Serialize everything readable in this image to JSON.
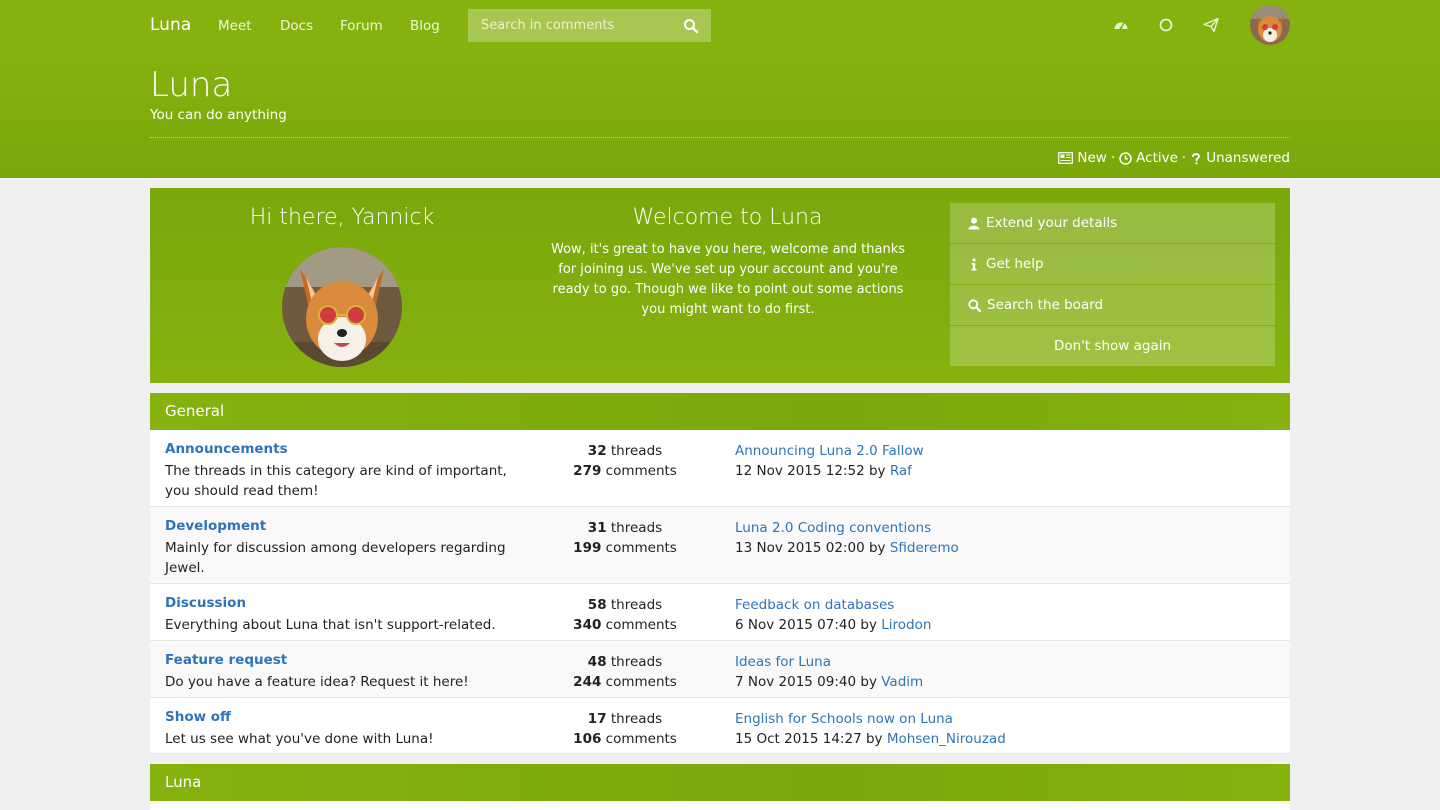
{
  "navbar": {
    "brand": "Luna",
    "links": [
      "Meet",
      "Docs",
      "Forum",
      "Blog"
    ],
    "search_placeholder": "Search in comments",
    "icons": [
      "dashboard-icon",
      "circle-icon",
      "send-icon"
    ]
  },
  "header": {
    "title": "Luna",
    "subtitle": "You can do anything",
    "quick_links": [
      "New",
      "Active",
      "Unanswered"
    ]
  },
  "welcome": {
    "greeting": "Hi there, Yannick",
    "title": "Welcome to Luna",
    "text": "Wow, it's great to have you here, welcome and thanks for joining us. We've set up your account and you're ready to go. Though we like to point out some actions you might want to do first.",
    "actions": [
      "Extend your details",
      "Get help",
      "Search the board"
    ],
    "dismiss": "Don't show again"
  },
  "sections": [
    {
      "name": "General",
      "forums": [
        {
          "name": "Announcements",
          "description": "The threads in this category are kind of important, you should read them!",
          "threads": "32",
          "comments": "279",
          "last_thread": "Announcing Luna 2.0 Fallow",
          "last_date": "12 Nov 2015 12:52",
          "last_user": "Raf"
        },
        {
          "name": "Development",
          "description": "Mainly for discussion among developers regarding Jewel.",
          "threads": "31",
          "comments": "199",
          "last_thread": "Luna 2.0 Coding conventions",
          "last_date": "13 Nov 2015 02:00",
          "last_user": "Sfideremo"
        },
        {
          "name": "Discussion",
          "description": "Everything about Luna that isn't support-related.",
          "threads": "58",
          "comments": "340",
          "last_thread": "Feedback on databases",
          "last_date": "6 Nov 2015 07:40",
          "last_user": "Lirodon"
        },
        {
          "name": "Feature request",
          "description": "Do you have a feature idea? Request it here!",
          "threads": "48",
          "comments": "244",
          "last_thread": "Ideas for Luna",
          "last_date": "7 Nov 2015 09:40",
          "last_user": "Vadim"
        },
        {
          "name": "Show off",
          "description": "Let us see what you've done with Luna!",
          "threads": "17",
          "comments": "106",
          "last_thread": "English for Schools now on Luna",
          "last_date": "15 Oct 2015 14:27",
          "last_user": "Mohsen_Nirouzad"
        }
      ]
    },
    {
      "name": "Luna",
      "forums": []
    }
  ],
  "labels": {
    "threads": "threads",
    "comments": "comments",
    "by": "by"
  },
  "colors": {
    "brand_green": "#86b20f",
    "link_blue": "#2d75b8"
  }
}
